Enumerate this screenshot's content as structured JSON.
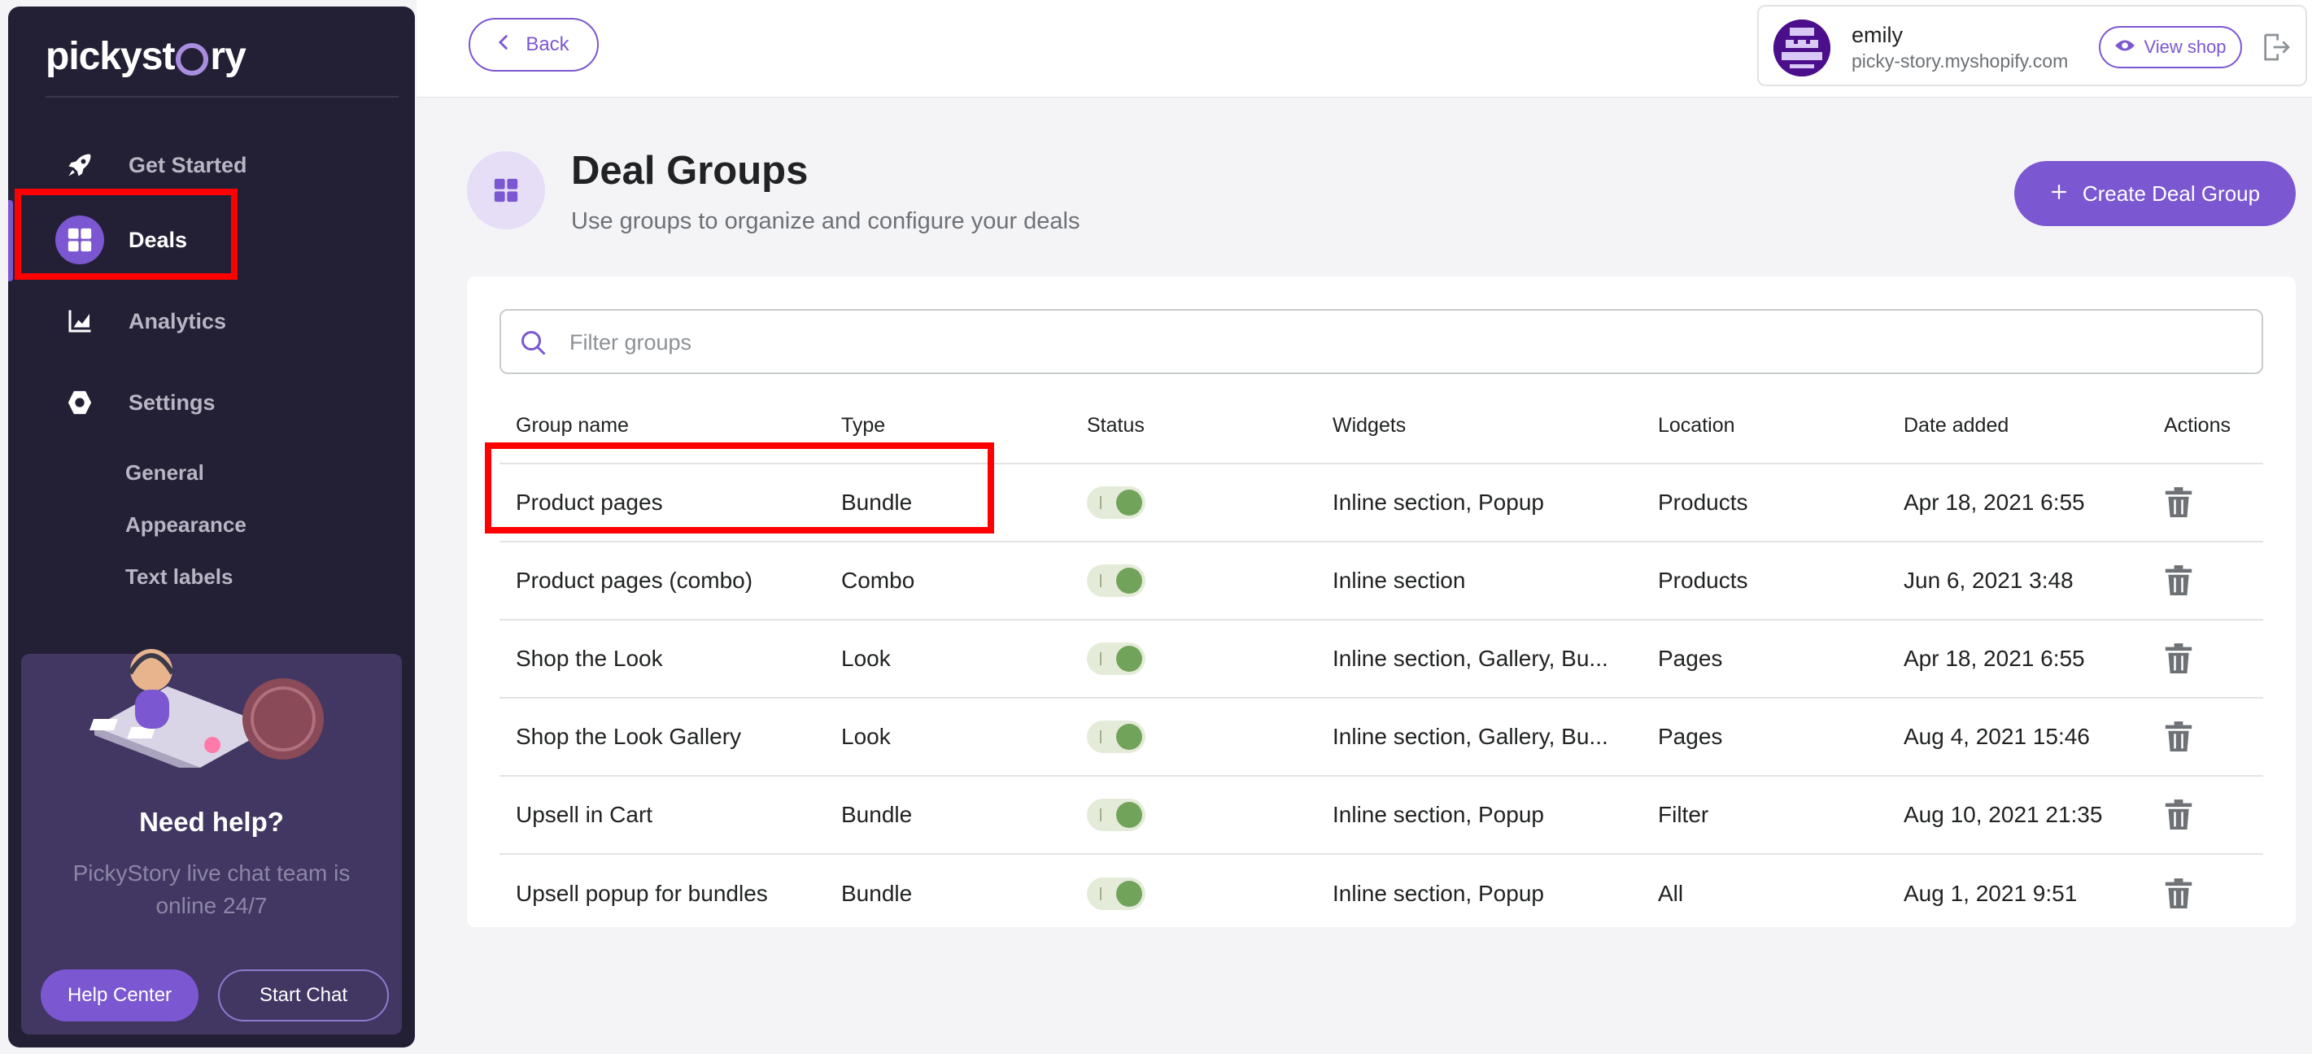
{
  "sidebar": {
    "logo": {
      "before": "pickyst",
      "after": "ry"
    },
    "nav": [
      {
        "label": "Get Started",
        "icon": "rocket-icon"
      },
      {
        "label": "Deals",
        "icon": "grid-icon",
        "active": true
      },
      {
        "label": "Analytics",
        "icon": "chart-icon"
      },
      {
        "label": "Settings",
        "icon": "hexagon-icon"
      }
    ],
    "sub_items": [
      "General",
      "Appearance",
      "Text labels"
    ],
    "help": {
      "title": "Need help?",
      "subtitle": "PickyStory live chat team is online 24/7",
      "help_center_label": "Help Center",
      "start_chat_label": "Start Chat"
    }
  },
  "header": {
    "back_label": "Back",
    "user": {
      "name": "emily",
      "shop": "picky-story.myshopify.com",
      "view_shop_label": "View shop"
    }
  },
  "page": {
    "title": "Deal Groups",
    "subtitle": "Use groups to organize and configure your deals",
    "create_label": "Create Deal Group"
  },
  "filter": {
    "placeholder": "Filter groups",
    "value": ""
  },
  "table": {
    "headers": [
      "Group name",
      "Type",
      "Status",
      "Widgets",
      "Location",
      "Date added",
      "Actions"
    ],
    "rows": [
      {
        "name": "Product pages",
        "type": "Bundle",
        "status": "on",
        "widgets": "Inline section, Popup",
        "location": "Products",
        "date": "Apr 18, 2021 6:55"
      },
      {
        "name": "Product pages (combo)",
        "type": "Combo",
        "status": "on",
        "widgets": "Inline section",
        "location": "Products",
        "date": "Jun 6, 2021 3:48"
      },
      {
        "name": "Shop the Look",
        "type": "Look",
        "status": "on",
        "widgets": "Inline section, Gallery, Bu...",
        "location": "Pages",
        "date": "Apr 18, 2021 6:55"
      },
      {
        "name": "Shop the Look Gallery",
        "type": "Look",
        "status": "on",
        "widgets": "Inline section, Gallery, Bu...",
        "location": "Pages",
        "date": "Aug 4, 2021 15:46"
      },
      {
        "name": "Upsell in Cart",
        "type": "Bundle",
        "status": "on",
        "widgets": "Inline section, Popup",
        "location": "Filter",
        "date": "Aug 10, 2021 21:35"
      },
      {
        "name": "Upsell popup for bundles",
        "type": "Bundle",
        "status": "on",
        "widgets": "Inline section, Popup",
        "location": "All",
        "date": "Aug 1, 2021 9:51"
      }
    ]
  },
  "colors": {
    "accent": "#7b57d1",
    "sidebar_bg": "#232036",
    "toggle_on": "#72a35b",
    "highlight": "#ff0000"
  }
}
